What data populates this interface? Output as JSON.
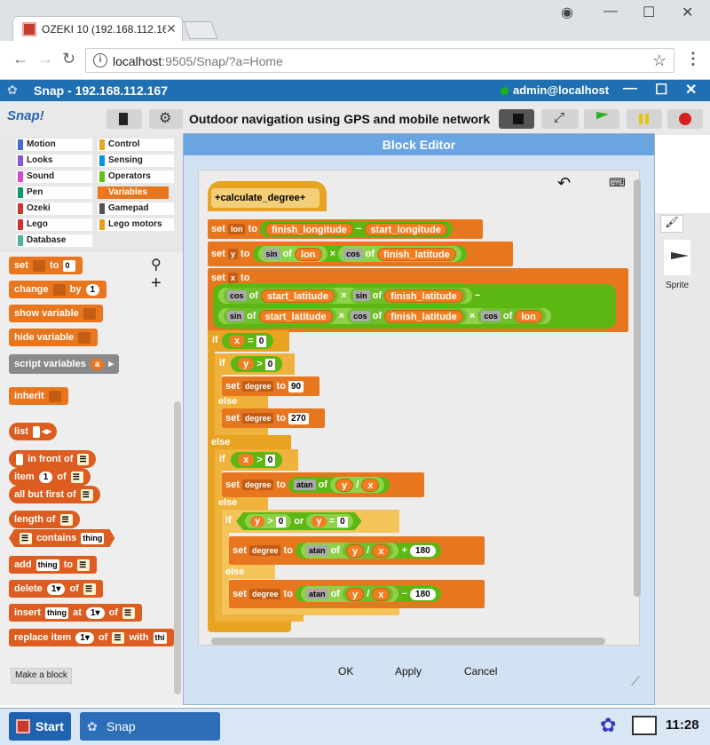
{
  "browser": {
    "tab_title": "OZEKI 10 (192.168.112.16",
    "url_host": "localhost",
    "url_rest": ":9505/Snap/?a=Home"
  },
  "app": {
    "title": "Snap - 192.168.112.167",
    "user": "admin@localhost"
  },
  "toolbar": {
    "logo": "Snap!",
    "project_title": "Outdoor navigation using GPS and mobile network"
  },
  "categories": [
    {
      "label": "Motion",
      "color": "#4a6cd4"
    },
    {
      "label": "Control",
      "color": "#e6a822"
    },
    {
      "label": "Looks",
      "color": "#8a55d7"
    },
    {
      "label": "Sensing",
      "color": "#0494dc"
    },
    {
      "label": "Sound",
      "color": "#cf4ad9"
    },
    {
      "label": "Operators",
      "color": "#62c213"
    },
    {
      "label": "Pen",
      "color": "#0e9a6c"
    },
    {
      "label": "Variables",
      "color": "#f3761d"
    },
    {
      "label": "Ozeki",
      "color": "#c63b2e"
    },
    {
      "label": "Gamepad",
      "color": "#555555"
    },
    {
      "label": "Lego",
      "color": "#d62f2f"
    },
    {
      "label": "Lego motors",
      "color": "#ea9f1a"
    },
    {
      "label": "Database",
      "color": "#4fb39d"
    }
  ],
  "palette": {
    "set": "set",
    "to": "to",
    "set_val": "0",
    "change": "change",
    "by": "by",
    "change_val": "1",
    "show_variable": "show variable",
    "hide_variable": "hide variable",
    "script_variables": "script variables",
    "script_var_a": "a",
    "inherit": "inherit",
    "list": "list",
    "in_front_of": "in front of",
    "item": "item",
    "item_val": "1",
    "of": "of",
    "all_but_first_of": "all but first of",
    "length_of": "length of",
    "contains": "contains",
    "thing": "thing",
    "add": "add",
    "delete": "delete",
    "delete_val": "1",
    "insert": "insert",
    "at": "at",
    "replace_item": "replace item",
    "with": "with",
    "with_val": "thi",
    "make_a_block": "Make a block"
  },
  "dialog": {
    "title": "Block Editor",
    "ok": "OK",
    "apply": "Apply",
    "cancel": "Cancel"
  },
  "script": {
    "hat_label": "calculate_degree",
    "kw_set": "set",
    "kw_to": "to",
    "kw_of": "of",
    "kw_if": "if",
    "kw_else": "else",
    "kw_or": "or",
    "v_lon": "lon",
    "v_y": "y",
    "v_x": "x",
    "v_degree": "degree",
    "finish_longitude": "finish_longitude",
    "start_longitude": "start_longitude",
    "start_latitude": "start_latitude",
    "finish_latitude": "finish_latitude",
    "sin": "sin",
    "cos": "cos",
    "atan": "atan",
    "minus": "−",
    "times": "×",
    "plus": "+",
    "div": "/",
    "gt": ">",
    "eq": "=",
    "n0": "0",
    "n90": "90",
    "n270": "270",
    "n180": "180"
  },
  "stage": {
    "sprite": "Sprite"
  },
  "taskbar": {
    "start": "Start",
    "snap": "Snap",
    "clock": "11:28"
  }
}
